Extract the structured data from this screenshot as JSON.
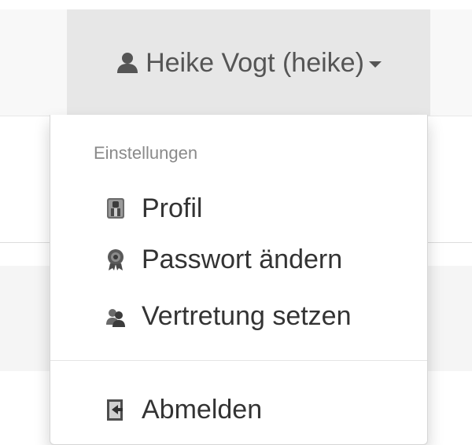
{
  "navbar": {
    "user_label": "Heike Vogt (heike)",
    "user_icon": "user-icon",
    "caret_icon": "caret-down-icon"
  },
  "dropdown": {
    "header": "Einstellungen",
    "items": [
      {
        "label": "Profil",
        "icon": "profile-icon"
      },
      {
        "label": "Passwort ändern",
        "icon": "password-seal-icon"
      },
      {
        "label": "Vertretung setzen",
        "icon": "substitute-users-icon"
      },
      {
        "label": "Abmelden",
        "icon": "logout-icon"
      }
    ]
  }
}
